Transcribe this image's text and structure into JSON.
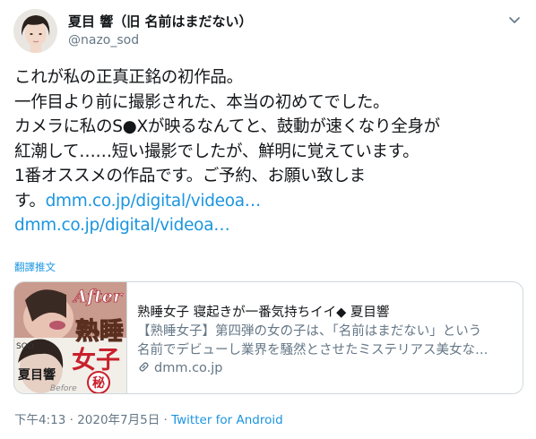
{
  "author": {
    "display_name": "夏目 響（旧 名前はまだない）",
    "handle": "@nazo_sod",
    "avatar_icon": "profile-photo"
  },
  "tweet": {
    "lines": [
      "これが私の正真正銘の初作品。",
      "一作目より前に撮影された、本当の初めてでした。",
      "カメラに私のS●Xが映るなんてと、鼓動が速くなり全身が",
      "紅潮して……短い撮影でしたが、鮮明に覚えています。",
      "1番オススメの作品です。ご予約、お願い致しま"
    ],
    "last_line_prefix": "す。",
    "link_1": "dmm.co.jp/digital/videoa…",
    "link_2": "dmm.co.jp/digital/videoa…",
    "translate_label": "翻譯推文"
  },
  "card": {
    "title": "熟睡女子 寝起きが一番気持ちイイ◆ 夏目響",
    "description_lines": [
      "【熟睡女子】第四弾の女の子は、「名前はまだない」という",
      "名前でデビューし業界を騒然とさせたミステリアス美女な…"
    ],
    "domain": "dmm.co.jp",
    "thumb_text": {
      "after": "After",
      "title_1": "熟睡",
      "title_2": "女子",
      "name": "夏目響",
      "badge": "秘",
      "label": "SOD",
      "before": "Before"
    }
  },
  "meta": {
    "time": "下午4:13",
    "separator_1": " · ",
    "date": "2020年7月5日",
    "separator_2": " · ",
    "source": "Twitter for Android"
  },
  "colors": {
    "link": "#1b95e0",
    "secondary_text": "#657786",
    "primary_text": "#14171a",
    "border": "#cfd9de"
  }
}
